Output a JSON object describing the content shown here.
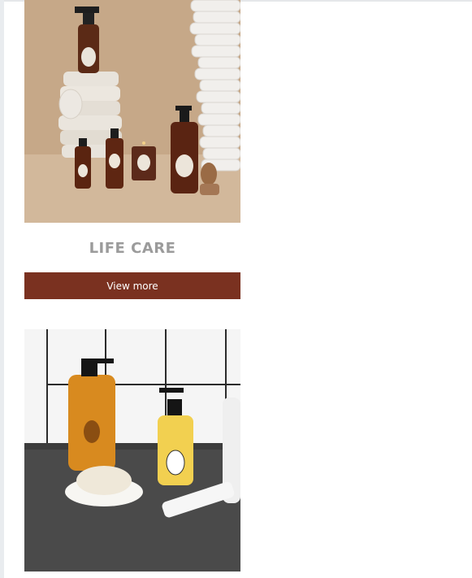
{
  "cards": [
    {
      "image_alt": "Life care products: spray bottle, soap bottles and candle with stacked towels and plates",
      "title": "LIFE CARE",
      "button_label": "View more"
    },
    {
      "image_alt": "Bathroom products: amber shower gel, hand wash, soap bar on a dish and a cream tube"
    }
  ],
  "colors": {
    "button_bg": "#7a3120",
    "title_text": "#9b9b9b"
  }
}
